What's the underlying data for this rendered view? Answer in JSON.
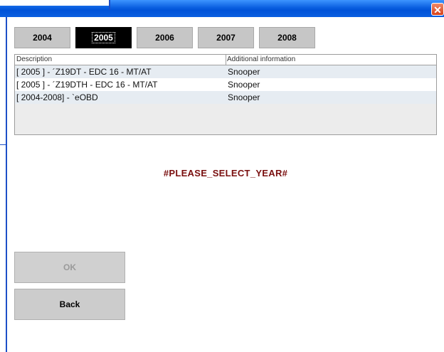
{
  "window": {
    "close_label": "✕"
  },
  "tabs": [
    {
      "label": "2004",
      "selected": false
    },
    {
      "label": "2005",
      "selected": true
    },
    {
      "label": "2006",
      "selected": false
    },
    {
      "label": "2007",
      "selected": false
    },
    {
      "label": "2008",
      "selected": false
    }
  ],
  "table": {
    "headers": [
      "Description",
      "Additional information"
    ],
    "rows": [
      [
        "[ 2005 ] - ´Z19DT - EDC 16 - MT/AT",
        "Snooper"
      ],
      [
        "[ 2005 ] - ´Z19DTH - EDC 16 - MT/AT",
        "Snooper"
      ],
      [
        "[ 2004-2008] - `eOBD",
        "Snooper"
      ]
    ]
  },
  "message": "#PLEASE_SELECT_YEAR#",
  "buttons": {
    "ok_label": "OK",
    "back_label": "Back"
  },
  "colors": {
    "titlebar": "#0a5fe0",
    "message": "#7a0f0f",
    "selected_tab": "#000000"
  }
}
